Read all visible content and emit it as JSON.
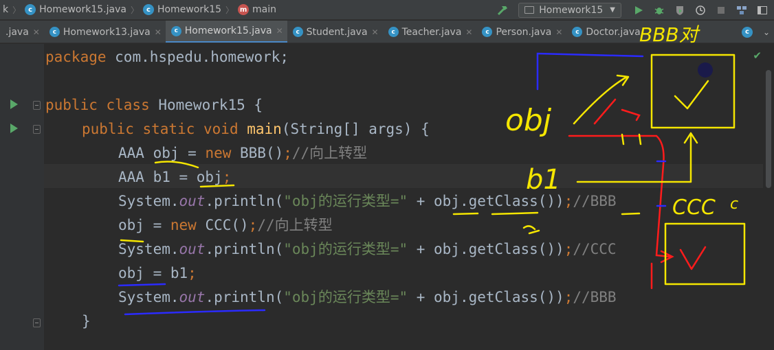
{
  "breadcrumbs": {
    "project_fragment": "k",
    "file": "Homework15.java",
    "class": "Homework15",
    "method": "main"
  },
  "toolbar": {
    "run_config": "Homework15"
  },
  "tabs": [
    {
      "label": ".java",
      "icon": "",
      "active": false
    },
    {
      "label": "Homework13.java",
      "icon": "class-icon",
      "active": false
    },
    {
      "label": "Homework15.java",
      "icon": "class-icon",
      "active": true
    },
    {
      "label": "Student.java",
      "icon": "class-icon",
      "active": false
    },
    {
      "label": "Teacher.java",
      "icon": "class-icon",
      "active": false
    },
    {
      "label": "Person.java",
      "icon": "class-icon",
      "active": false
    },
    {
      "label": "Doctor.java",
      "icon": "class-icon",
      "active": false
    }
  ],
  "code": {
    "l1": {
      "kw": "package",
      "rest": " com.hspedu.homework;"
    },
    "l2": {
      "kw1": "public",
      "kw2": " class",
      "rest": " Homework15 {"
    },
    "l3": {
      "kw1": "public",
      "kw2": " static",
      "kw3": " void",
      "fn": " main",
      "rest": "(String[] args) {"
    },
    "l4": {
      "a": "AAA obj = ",
      "kw": "new",
      "b": " BBB()",
      "semi": ";",
      "cmt": "//向上转型"
    },
    "l5": {
      "a": "AAA b1 = obj",
      "semi": ";"
    },
    "l6": {
      "a": "System.",
      "fld": "out",
      "b": ".println(",
      "str": "\"obj的运行类型=\"",
      "c": " + obj.getClass())",
      "semi": ";",
      "cmt": "//BBB"
    },
    "l7": {
      "a": "obj = ",
      "kw": "new",
      "b": " CCC()",
      "semi": ";",
      "cmt": "//向上转型"
    },
    "l8": {
      "a": "System.",
      "fld": "out",
      "b": ".println(",
      "str": "\"obj的运行类型=\"",
      "c": " + obj.getClass())",
      "semi": ";",
      "cmt": "//CCC"
    },
    "l9": {
      "a": "obj = b1",
      "semi": ";"
    },
    "l10": {
      "a": "System.",
      "fld": "out",
      "b": ".println(",
      "str": "\"obj的运行类型=\"",
      "c": " + obj.getClass())",
      "semi": ";",
      "cmt": "//BBB"
    },
    "l11": {
      "a": "}"
    }
  },
  "annotations": {
    "bbb_label": "BBB对",
    "obj_label": "obj",
    "b1_label": "b1",
    "ccc_label": "CCC",
    "ccc_mark": "c"
  },
  "colors": {
    "keyword": "#cc7832",
    "string": "#6a8759",
    "comment": "#808080",
    "static_field": "#9876aa",
    "method_decl": "#ffc66d",
    "ink_yellow": "#f5e600",
    "ink_blue": "#1f1fe0",
    "ink_red": "#e81010"
  }
}
